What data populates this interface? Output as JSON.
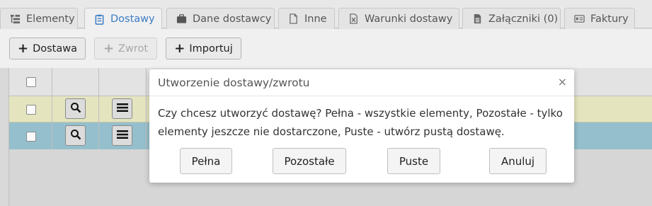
{
  "tabs": [
    {
      "label": "Elementy",
      "icon": "list-tree-icon",
      "active": false
    },
    {
      "label": "Dostawy",
      "icon": "clipboard-list-icon",
      "active": true
    },
    {
      "label": "Dane dostawcy",
      "icon": "briefcase-icon",
      "active": false
    },
    {
      "label": "Inne",
      "icon": "file-icon",
      "active": false
    },
    {
      "label": "Warunki dostawy",
      "icon": "excel-file-icon",
      "active": false
    },
    {
      "label": "Załączniki (0)",
      "icon": "file-text-icon",
      "active": false
    },
    {
      "label": "Faktury",
      "icon": "invoice-card-icon",
      "active": false
    }
  ],
  "toolbar": {
    "add_delivery_label": "Dostawa",
    "return_label": "Zwrot",
    "import_label": "Importuj"
  },
  "dialog": {
    "title": "Utworzenie dostawy/zwrotu",
    "close_symbol": "×",
    "message": "Czy chcesz utworzyć dostawę? Pełna - wszystkie elementy, Pozostałe - tylko elementy jeszcze nie dostarczone, Puste - utwórz pustą dostawę.",
    "buttons": {
      "full": "Pełna",
      "remaining": "Pozostałe",
      "empty": "Puste",
      "cancel": "Anuluj"
    }
  },
  "colors": {
    "active_tab": "#3b7dc4",
    "row_highlight_yellow": "#e4e4bf",
    "row_selected_blue": "#95bfcc"
  }
}
